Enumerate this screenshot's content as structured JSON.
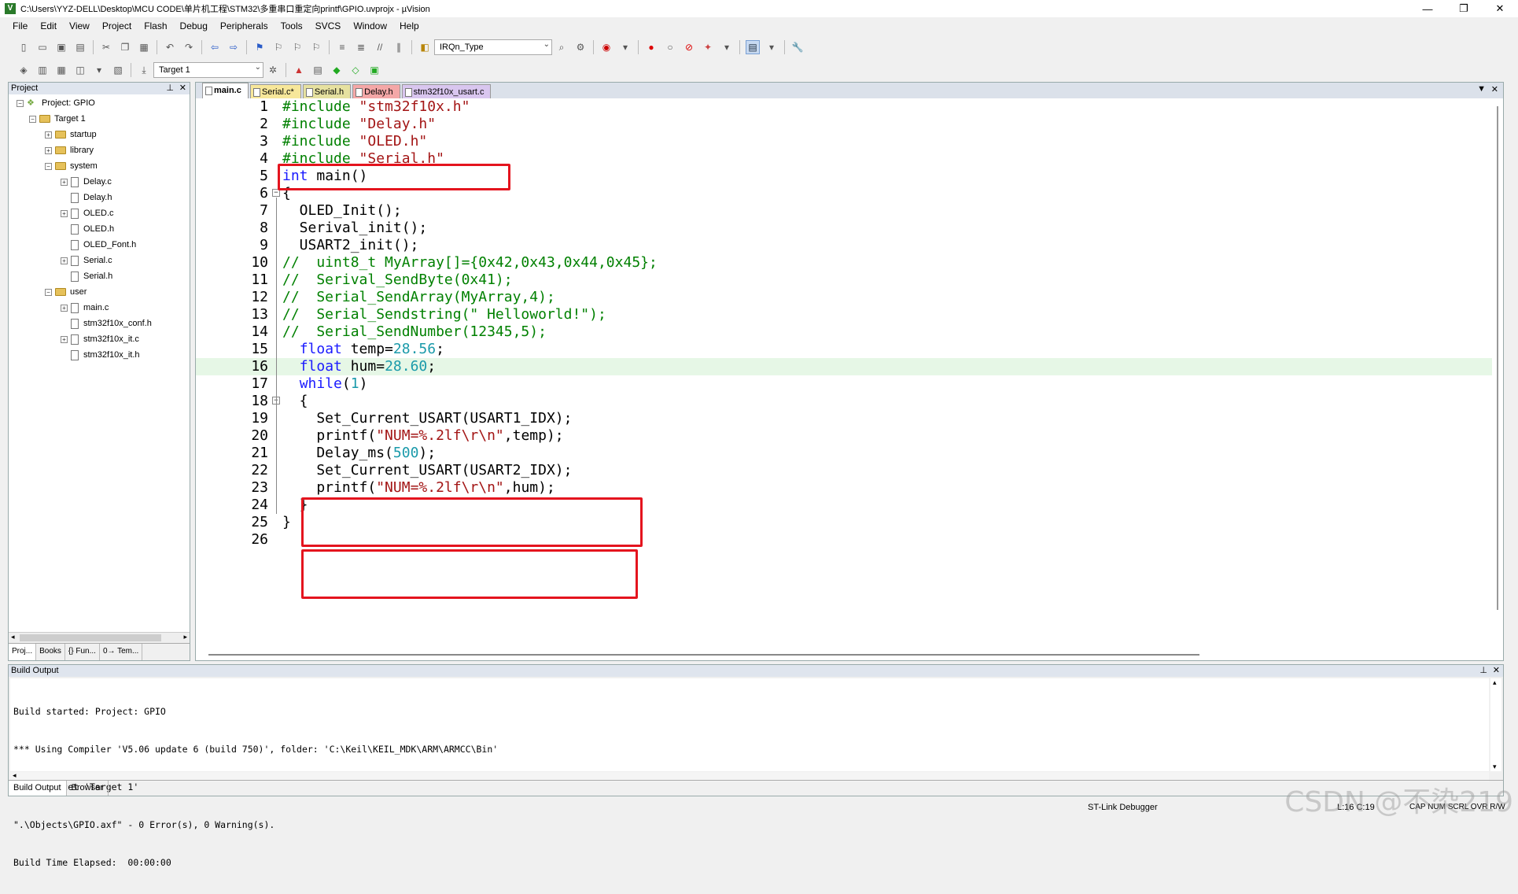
{
  "window": {
    "title": "C:\\Users\\YYZ-DELL\\Desktop\\MCU CODE\\单片机工程\\STM32\\多重串口重定向printf\\GPIO.uvprojx - µVision",
    "app_icon": "V",
    "controls": [
      "—",
      "❐",
      "✕"
    ]
  },
  "menu": [
    "File",
    "Edit",
    "View",
    "Project",
    "Flash",
    "Debug",
    "Peripherals",
    "Tools",
    "SVCS",
    "Window",
    "Help"
  ],
  "toolbar1": {
    "find_combo": "IRQn_Type"
  },
  "toolbar2": {
    "target_combo": "Target 1"
  },
  "project_panel": {
    "title": "Project",
    "pin": "⊥",
    "close": "✕",
    "tree": [
      {
        "label": "Project: GPIO",
        "level": 0,
        "kind": "project",
        "exp": "−"
      },
      {
        "label": "Target 1",
        "level": 1,
        "kind": "target",
        "exp": "−"
      },
      {
        "label": "startup",
        "level": 2,
        "kind": "folder",
        "exp": "+"
      },
      {
        "label": "library",
        "level": 2,
        "kind": "folder",
        "exp": "+"
      },
      {
        "label": "system",
        "level": 2,
        "kind": "folder",
        "exp": "−"
      },
      {
        "label": "Delay.c",
        "level": 3,
        "kind": "file",
        "exp": "+"
      },
      {
        "label": "Delay.h",
        "level": 3,
        "kind": "file",
        "exp": ""
      },
      {
        "label": "OLED.c",
        "level": 3,
        "kind": "file",
        "exp": "+"
      },
      {
        "label": "OLED.h",
        "level": 3,
        "kind": "file",
        "exp": ""
      },
      {
        "label": "OLED_Font.h",
        "level": 3,
        "kind": "file",
        "exp": ""
      },
      {
        "label": "Serial.c",
        "level": 3,
        "kind": "file",
        "exp": "+"
      },
      {
        "label": "Serial.h",
        "level": 3,
        "kind": "file",
        "exp": ""
      },
      {
        "label": "user",
        "level": 2,
        "kind": "folder",
        "exp": "−"
      },
      {
        "label": "main.c",
        "level": 3,
        "kind": "file",
        "exp": "+"
      },
      {
        "label": "stm32f10x_conf.h",
        "level": 3,
        "kind": "file",
        "exp": ""
      },
      {
        "label": "stm32f10x_it.c",
        "level": 3,
        "kind": "file",
        "exp": "+"
      },
      {
        "label": "stm32f10x_it.h",
        "level": 3,
        "kind": "file",
        "exp": ""
      }
    ],
    "tabs": [
      "Proj...",
      "Books",
      "{} Fun...",
      "0→ Tem..."
    ]
  },
  "editor": {
    "tabs": [
      {
        "label": "main.c",
        "color": "#ffffff",
        "active": true
      },
      {
        "label": "Serial.c*",
        "color": "#f7e79a",
        "active": false
      },
      {
        "label": "Serial.h",
        "color": "#e6e1a0",
        "active": false
      },
      {
        "label": "Delay.h",
        "color": "#f4a7a7",
        "active": false
      },
      {
        "label": "stm32f10x_usart.c",
        "color": "#d9c6ef",
        "active": false
      }
    ],
    "tab_menu": "▼",
    "tab_close": "✕",
    "lines": [
      {
        "n": "1",
        "fold": "",
        "tokens": [
          {
            "t": "#include ",
            "c": "cm"
          },
          {
            "t": "\"stm32f10x.h\"",
            "c": "str"
          }
        ]
      },
      {
        "n": "2",
        "fold": "",
        "tokens": [
          {
            "t": "#include ",
            "c": "cm"
          },
          {
            "t": "\"Delay.h\"",
            "c": "str"
          }
        ]
      },
      {
        "n": "3",
        "fold": "",
        "tokens": [
          {
            "t": "#include ",
            "c": "cm"
          },
          {
            "t": "\"OLED.h\"",
            "c": "str"
          }
        ]
      },
      {
        "n": "4",
        "fold": "",
        "tokens": [
          {
            "t": "#include ",
            "c": "cm"
          },
          {
            "t": "\"Serial.h\"",
            "c": "str"
          }
        ]
      },
      {
        "n": "5",
        "fold": "",
        "tokens": [
          {
            "t": "int",
            "c": "kw"
          },
          {
            "t": " main()",
            "c": ""
          }
        ]
      },
      {
        "n": "6",
        "fold": "−",
        "tokens": [
          {
            "t": "{",
            "c": ""
          }
        ]
      },
      {
        "n": "7",
        "fold": "",
        "tokens": [
          {
            "t": "  OLED_Init();",
            "c": ""
          }
        ]
      },
      {
        "n": "8",
        "fold": "",
        "tokens": [
          {
            "t": "  Serival_init();",
            "c": ""
          }
        ]
      },
      {
        "n": "9",
        "fold": "",
        "tokens": [
          {
            "t": "  USART2_init();",
            "c": ""
          }
        ]
      },
      {
        "n": "10",
        "fold": "",
        "tokens": [
          {
            "t": "//  uint8_t MyArray[]={0x42,0x43,0x44,0x45};",
            "c": "cm"
          }
        ]
      },
      {
        "n": "11",
        "fold": "",
        "tokens": [
          {
            "t": "//  Serival_SendByte(0x41);",
            "c": "cm"
          }
        ]
      },
      {
        "n": "12",
        "fold": "",
        "tokens": [
          {
            "t": "//  Serial_SendArray(MyArray,4);",
            "c": "cm"
          }
        ]
      },
      {
        "n": "13",
        "fold": "",
        "tokens": [
          {
            "t": "//  Serial_Sendstring(\" Helloworld!\");",
            "c": "cm"
          }
        ]
      },
      {
        "n": "14",
        "fold": "",
        "tokens": [
          {
            "t": "//  Serial_SendNumber(12345,5);",
            "c": "cm"
          }
        ]
      },
      {
        "n": "15",
        "fold": "",
        "tokens": [
          {
            "t": "  ",
            "c": ""
          },
          {
            "t": "float",
            "c": "kw"
          },
          {
            "t": " temp=",
            "c": ""
          },
          {
            "t": "28.56",
            "c": "num"
          },
          {
            "t": ";",
            "c": ""
          }
        ]
      },
      {
        "n": "16",
        "fold": "",
        "hl": true,
        "tokens": [
          {
            "t": "  ",
            "c": ""
          },
          {
            "t": "float",
            "c": "kw"
          },
          {
            "t": " hum=",
            "c": ""
          },
          {
            "t": "28.60",
            "c": "num"
          },
          {
            "t": ";",
            "c": ""
          }
        ]
      },
      {
        "n": "17",
        "fold": "",
        "tokens": [
          {
            "t": "  ",
            "c": ""
          },
          {
            "t": "while",
            "c": "kw"
          },
          {
            "t": "(",
            "c": ""
          },
          {
            "t": "1",
            "c": "num"
          },
          {
            "t": ")",
            "c": ""
          }
        ]
      },
      {
        "n": "18",
        "fold": "−",
        "tokens": [
          {
            "t": "  {",
            "c": ""
          }
        ]
      },
      {
        "n": "19",
        "fold": "",
        "tokens": [
          {
            "t": "    Set_Current_USART(USART1_IDX);",
            "c": ""
          }
        ]
      },
      {
        "n": "20",
        "fold": "",
        "tokens": [
          {
            "t": "    printf(",
            "c": ""
          },
          {
            "t": "\"NUM=%.2lf\\r\\n\"",
            "c": "str"
          },
          {
            "t": ",temp);",
            "c": ""
          }
        ]
      },
      {
        "n": "21",
        "fold": "",
        "tokens": [
          {
            "t": "    Delay_ms(",
            "c": ""
          },
          {
            "t": "500",
            "c": "num"
          },
          {
            "t": ");",
            "c": ""
          }
        ]
      },
      {
        "n": "22",
        "fold": "",
        "tokens": [
          {
            "t": "    Set_Current_USART(USART2_IDX);",
            "c": ""
          }
        ]
      },
      {
        "n": "23",
        "fold": "",
        "tokens": [
          {
            "t": "    printf(",
            "c": ""
          },
          {
            "t": "\"NUM=%.2lf\\r\\n\"",
            "c": "str"
          },
          {
            "t": ",hum);",
            "c": ""
          }
        ]
      },
      {
        "n": "24",
        "fold": "",
        "tokens": [
          {
            "t": "  }",
            "c": ""
          }
        ]
      },
      {
        "n": "25",
        "fold": "",
        "tokens": [
          {
            "t": "}",
            "c": ""
          }
        ]
      },
      {
        "n": "26",
        "fold": "",
        "tokens": []
      }
    ]
  },
  "build_output": {
    "title": "Build Output",
    "lines": [
      "Build started: Project: GPIO",
      "*** Using Compiler 'V5.06 update 6 (build 750)', folder: 'C:\\Keil\\KEIL_MDK\\ARM\\ARMCC\\Bin'",
      "Build target 'Target 1'",
      "\".\\Objects\\GPIO.axf\" - 0 Error(s), 0 Warning(s).",
      "Build Time Elapsed:  00:00:00"
    ],
    "tabs": [
      "Build Output",
      "Browser"
    ]
  },
  "status": {
    "debugger": "ST-Link Debugger",
    "position": "L:16 C:19",
    "indicators": "CAP  NUM  SCRL  OVR  R/W"
  },
  "watermark": "CSDN @不染219",
  "colors": {
    "keyword": "#1a1aff",
    "string": "#a31515",
    "comment": "#008000",
    "number": "#1a9aaa",
    "highlight_line": "#e6f7e6",
    "annotation_box": "#e4141e"
  }
}
